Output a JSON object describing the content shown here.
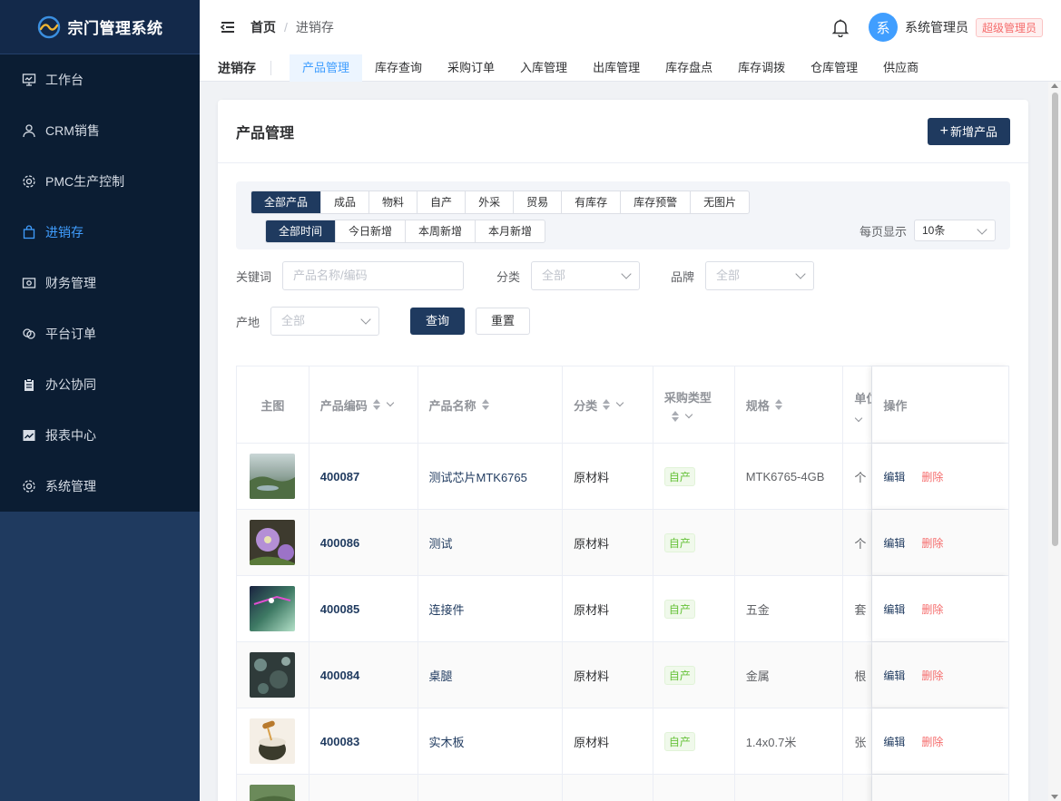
{
  "app": {
    "title": "宗门管理系统"
  },
  "sidebar": {
    "items": [
      {
        "label": "工作台",
        "icon": "monitor-icon"
      },
      {
        "label": "CRM销售",
        "icon": "user-icon"
      },
      {
        "label": "PMC生产控制",
        "icon": "gear-icon"
      },
      {
        "label": "进销存",
        "icon": "bag-icon",
        "active": true
      },
      {
        "label": "财务管理",
        "icon": "money-icon"
      },
      {
        "label": "平台订单",
        "icon": "link-icon"
      },
      {
        "label": "办公协同",
        "icon": "clipboard-icon"
      },
      {
        "label": "报表中心",
        "icon": "chart-icon"
      },
      {
        "label": "系统管理",
        "icon": "settings-icon"
      }
    ]
  },
  "header": {
    "breadcrumb_home": "首页",
    "breadcrumb_sep": "/",
    "breadcrumb_current": "进销存",
    "avatar_text": "系",
    "user_name": "系统管理员",
    "role": "超级管理员"
  },
  "subnav": {
    "title": "进销存",
    "tabs": [
      "产品管理",
      "库存查询",
      "采购订单",
      "入库管理",
      "出库管理",
      "库存盘点",
      "库存调拨",
      "仓库管理",
      "供应商"
    ]
  },
  "page": {
    "title": "产品管理",
    "add_button": "新增产品",
    "add_plus": "+"
  },
  "filters": {
    "category_tabs": [
      "全部产品",
      "成品",
      "物料",
      "自产",
      "外采",
      "贸易",
      "有库存",
      "库存预警",
      "无图片"
    ],
    "time_tabs": [
      "全部时间",
      "今日新增",
      "本周新增",
      "本月新增"
    ],
    "per_page_label": "每页显示",
    "per_page_value": "10条",
    "keyword_label": "关键词",
    "keyword_placeholder": "产品名称/编码",
    "category_label": "分类",
    "category_value": "全部",
    "brand_label": "品牌",
    "brand_value": "全部",
    "origin_label": "产地",
    "origin_value": "全部",
    "search_button": "查询",
    "reset_button": "重置"
  },
  "table": {
    "headers": {
      "image": "主图",
      "code": "产品编码",
      "name": "产品名称",
      "category": "分类",
      "purchase_type": "采购类型",
      "spec": "规格",
      "unit": "单位",
      "ops": "操作"
    },
    "edit_label": "编辑",
    "delete_label": "删除",
    "rows": [
      {
        "code": "400087",
        "name": "测试芯片MTK6765",
        "category": "原材料",
        "purchase_type": "自产",
        "spec": "MTK6765-4GB",
        "unit": "个",
        "thumb": "landscape"
      },
      {
        "code": "400086",
        "name": "测试",
        "category": "原材料",
        "purchase_type": "自产",
        "spec": "",
        "unit": "个",
        "thumb": "flower"
      },
      {
        "code": "400085",
        "name": "连接件",
        "category": "原材料",
        "purchase_type": "自产",
        "spec": "五金",
        "unit": "套",
        "thumb": "space"
      },
      {
        "code": "400084",
        "name": "桌腿",
        "category": "原材料",
        "purchase_type": "自产",
        "spec": "金属",
        "unit": "根",
        "thumb": "rock"
      },
      {
        "code": "400083",
        "name": "实木板",
        "category": "原材料",
        "purchase_type": "自产",
        "spec": "1.4x0.7米",
        "unit": "张",
        "thumb": "honey"
      }
    ]
  },
  "colors": {
    "sidebar_bg": "#0b1d33",
    "accent": "#409eff",
    "primary_dark": "#1f3a5f",
    "danger": "#f56c6c",
    "success": "#67c23a"
  }
}
